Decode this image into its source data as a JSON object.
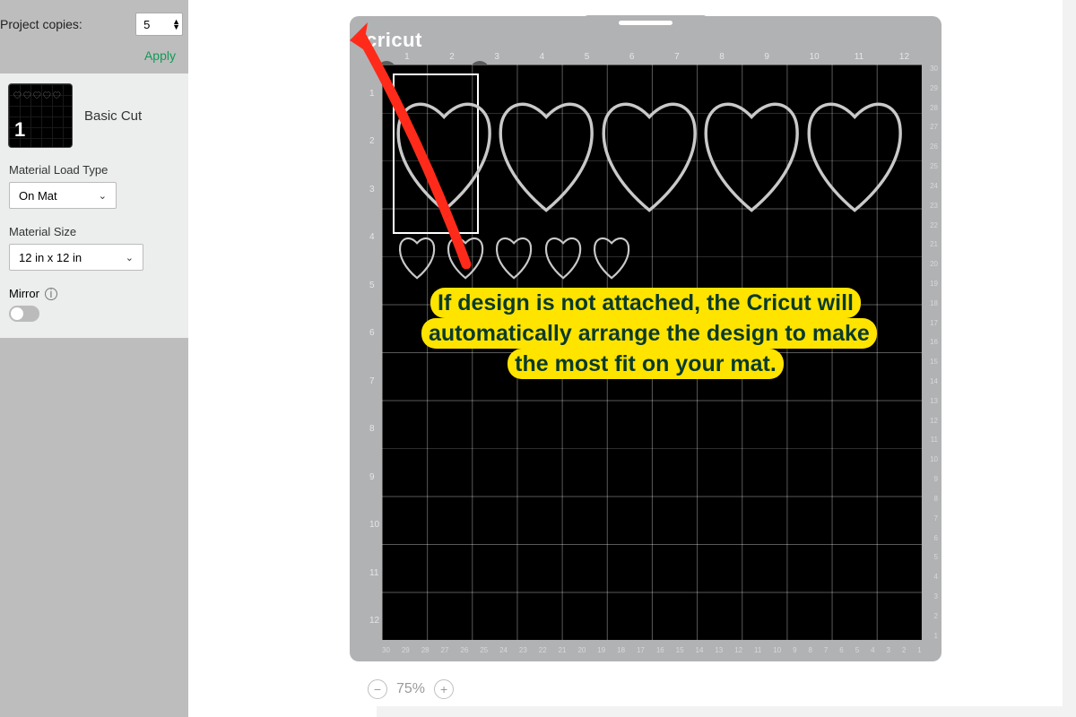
{
  "sidebar": {
    "project_copies_label": "Project copies:",
    "project_copies_value": "5",
    "apply_label": "Apply",
    "mat": {
      "number": "1",
      "name": "Basic Cut"
    },
    "material_load_label": "Material Load Type",
    "material_load_value": "On Mat",
    "material_size_label": "Material Size",
    "material_size_value": "12 in x 12 in",
    "mirror_label": "Mirror"
  },
  "mat": {
    "brand": "cricut",
    "ruler_top": [
      "1",
      "2",
      "3",
      "4",
      "5",
      "6",
      "7",
      "8",
      "9",
      "10",
      "11",
      "12"
    ],
    "ruler_left": [
      "1",
      "2",
      "3",
      "4",
      "5",
      "6",
      "7",
      "8",
      "9",
      "10",
      "11",
      "12"
    ],
    "edge_right": [
      "30",
      "29",
      "28",
      "27",
      "26",
      "25",
      "24",
      "23",
      "22",
      "21",
      "20",
      "19",
      "18",
      "17",
      "16",
      "15",
      "14",
      "13",
      "12",
      "11",
      "10",
      "9",
      "8",
      "7",
      "6",
      "5",
      "4",
      "3",
      "2",
      "1"
    ],
    "edge_bottom": [
      "30",
      "29",
      "28",
      "27",
      "26",
      "25",
      "24",
      "23",
      "22",
      "21",
      "20",
      "19",
      "18",
      "17",
      "16",
      "15",
      "14",
      "13",
      "12",
      "11",
      "10",
      "9",
      "8",
      "7",
      "6",
      "5",
      "4",
      "3",
      "2",
      "1"
    ]
  },
  "zoom": {
    "value": "75%"
  },
  "annotation": {
    "text": "If design is not attached, the Cricut will automatically arrange the design to make the most fit on your mat."
  }
}
